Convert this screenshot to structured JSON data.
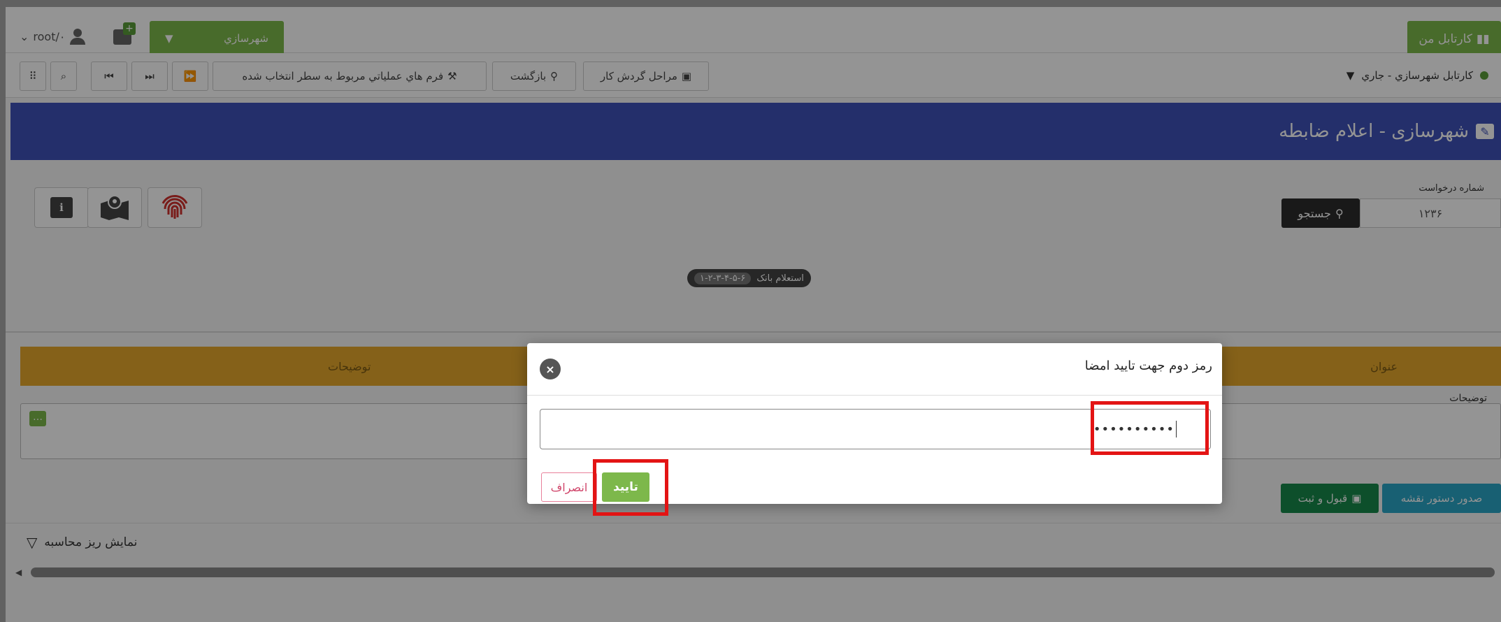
{
  "topbar": {
    "user_label": "root/٠",
    "module_label": "شهرسازي",
    "kartabl_label": "کارتابل من",
    "notification_badge": "+"
  },
  "toolbar": {
    "workflow_steps_label": "مراحل گردش کار",
    "back_label": "بازگشت",
    "forms_label": "فرم هاي عملياتي مربوط به سطر انتخاب شده",
    "kartabl_select_value": "کارتابل شهرسازي - جاري"
  },
  "header": {
    "title": "شهرسازی - اعلام ضابطه"
  },
  "search": {
    "label": "شماره درخواست",
    "value": "۱۲۳۶",
    "button_label": "جستجو"
  },
  "pill": {
    "label": "استعلام بانک",
    "code": "۱-۲-۳-۴-۵-۶"
  },
  "table": {
    "col_description": "توضيحات",
    "col_title": "عنوان"
  },
  "form": {
    "description_label": "توضیحات"
  },
  "actions": {
    "issue_map_order": "صدور دستور نقشه",
    "accept_save": "قبول و ثبت"
  },
  "calc_toggle": {
    "label": "نمایش ریز محاسبه"
  },
  "modal": {
    "title": "رمز دوم جهت تایید امضا",
    "password_value": "••••••••••",
    "confirm_label": "تایید",
    "cancel_label": "انصراف"
  },
  "colors": {
    "accent_green": "#7db84b",
    "header_blue": "#3e52b8",
    "table_header": "#e6a72c",
    "highlight_red": "#e31414"
  }
}
